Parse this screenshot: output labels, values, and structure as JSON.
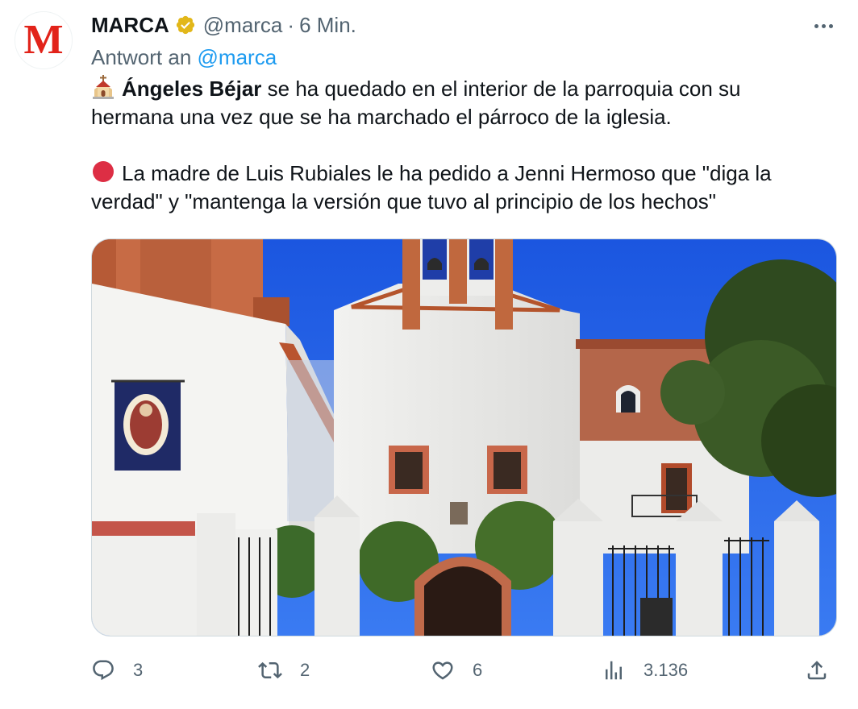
{
  "tweet": {
    "avatar_letter": "M",
    "author_name": "MARCA",
    "author_handle": "@marca",
    "separator": "·",
    "time": "6 Min.",
    "reply_prefix": "Antwort an",
    "reply_handle": "@marca",
    "paragraph1_bold": "Ángeles Béjar",
    "paragraph1_text": " se ha quedado en el interior de la parroquia con su hermana una vez que se ha marchado el párroco de la iglesia.",
    "paragraph2_text": "La madre de Luis Rubiales le ha pedido a Jenni Hermoso que \"diga la verdad\" y \"mantenga la versión que tuvo al principio de los hechos\"",
    "icons": {
      "paragraph1": "church-icon",
      "paragraph2": "red-circle-icon"
    },
    "colors": {
      "brand_red": "#e2231a",
      "verified_gold": "#e2b719",
      "link_blue": "#1d9bf0",
      "secondary_text": "#536471"
    }
  },
  "actions": {
    "replies": "3",
    "retweets": "2",
    "likes": "6",
    "views": "3.136"
  }
}
